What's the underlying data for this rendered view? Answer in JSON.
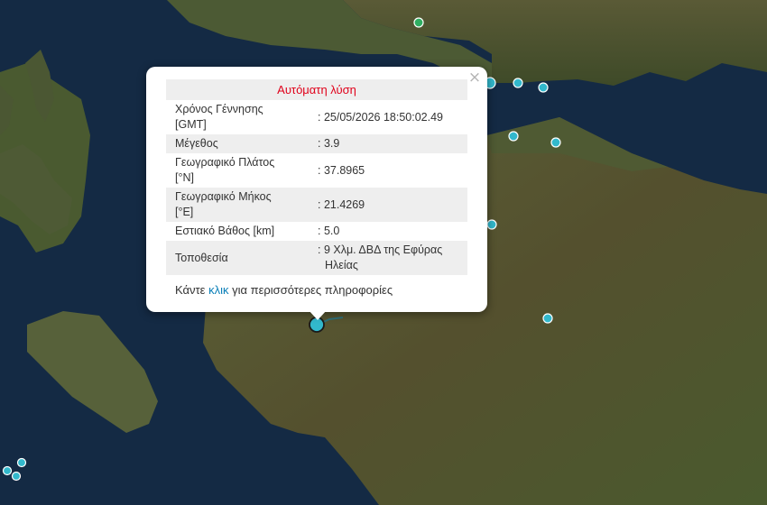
{
  "map": {
    "colors": {
      "sea": "#142a44",
      "land": "#4d5a32",
      "marker": "#32b8cc",
      "marker_green": "#2fae62"
    }
  },
  "popup": {
    "title": "Αυτόματη λύση",
    "close_symbol": "×",
    "rows": [
      {
        "key_line1": "Χρόνος Γέννησης",
        "key_line2": "[GMT]",
        "value": ": 25/05/2026 18:50:02.49"
      },
      {
        "key_line1": "Μέγεθος",
        "key_line2": "",
        "value": ": 3.9"
      },
      {
        "key_line1": "Γεωγραφικό Πλάτος",
        "key_line2": "[°N]",
        "value": ": 37.8965"
      },
      {
        "key_line1": "Γεωγραφικό Μήκος",
        "key_line2": "[°E]",
        "value": ": 21.4269"
      },
      {
        "key_line1": "Εστιακό Βάθος [km]",
        "key_line2": "",
        "value": ": 5.0"
      },
      {
        "key_line1": "Τοποθεσία",
        "key_line2": "",
        "value_line1": ": 9 Χλμ. ΔΒΔ της Εφύρας",
        "value_line2": "Ηλείας"
      }
    ],
    "more_prefix": "Κάντε",
    "more_link": "κλικ",
    "more_suffix": "για περισσότερες πληροφορίες"
  }
}
